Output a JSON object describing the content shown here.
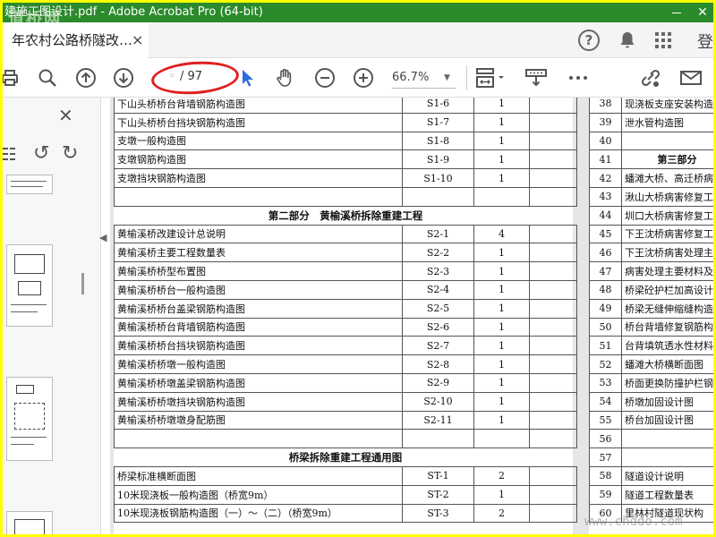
{
  "window": {
    "title": "建施工图设计.pdf - Adobe Acrobat Pro (64-bit)",
    "watermark": "道桥网",
    "close_glyph": "✕"
  },
  "tab": {
    "label": "年农村公路桥隧改…",
    "close_glyph": "×"
  },
  "header": {
    "help_glyph": "?",
    "signin_label": "登"
  },
  "toolbar": {
    "page_current": "",
    "page_total": "/ 97",
    "zoom": "66.7%"
  },
  "colors": {
    "titlebar": "#2b8a2b",
    "frame": "#ffff00",
    "highlight": "#e02020",
    "cursor": "#2d6cdf"
  },
  "left_table": {
    "rows": [
      {
        "kind": "row",
        "name": "下山头桥桥台背墙钢筋构造图",
        "code": "S1-6",
        "qty": "1"
      },
      {
        "kind": "row",
        "name": "下山头桥桥台挡块钢筋构造图",
        "code": "S1-7",
        "qty": "1"
      },
      {
        "kind": "row",
        "name": "支墩一般构造图",
        "code": "S1-8",
        "qty": "1"
      },
      {
        "kind": "row",
        "name": "支墩钢筋构造图",
        "code": "S1-9",
        "qty": "1"
      },
      {
        "kind": "row",
        "name": "支墩挡块钢筋构造图",
        "code": "S1-10",
        "qty": "1"
      },
      {
        "kind": "blank"
      },
      {
        "kind": "section",
        "name": "第二部分　黄榆溪桥拆除重建工程"
      },
      {
        "kind": "row",
        "name": "黄榆溪桥改建设计总说明",
        "code": "S2-1",
        "qty": "4"
      },
      {
        "kind": "row",
        "name": "黄榆溪桥主要工程数量表",
        "code": "S2-2",
        "qty": "1"
      },
      {
        "kind": "row",
        "name": "黄榆溪桥桥型布置图",
        "code": "S2-3",
        "qty": "1"
      },
      {
        "kind": "row",
        "name": "黄榆溪桥桥台一般构造图",
        "code": "S2-4",
        "qty": "1"
      },
      {
        "kind": "row",
        "name": "黄榆溪桥桥台盖梁钢筋构造图",
        "code": "S2-5",
        "qty": "1"
      },
      {
        "kind": "row",
        "name": "黄榆溪桥桥台背墙钢筋构造图",
        "code": "S2-6",
        "qty": "1"
      },
      {
        "kind": "row",
        "name": "黄榆溪桥桥台挡块钢筋构造图",
        "code": "S2-7",
        "qty": "1"
      },
      {
        "kind": "row",
        "name": "黄榆溪桥桥墩一般构造图",
        "code": "S2-8",
        "qty": "1"
      },
      {
        "kind": "row",
        "name": "黄榆溪桥桥墩盖梁钢筋构造图",
        "code": "S2-9",
        "qty": "1"
      },
      {
        "kind": "row",
        "name": "黄榆溪桥桥墩挡块钢筋构造图",
        "code": "S2-10",
        "qty": "1"
      },
      {
        "kind": "row",
        "name": "黄榆溪桥桥墩墩身配筋图",
        "code": "S2-11",
        "qty": "1"
      },
      {
        "kind": "blank"
      },
      {
        "kind": "section",
        "name": "桥梁拆除重建工程通用图"
      },
      {
        "kind": "row",
        "name": "桥梁标准横断面图",
        "code": "ST-1",
        "qty": "2"
      },
      {
        "kind": "row",
        "name": "10米现浇板一般构造图（桥宽9m）",
        "code": "ST-2",
        "qty": "1"
      },
      {
        "kind": "row",
        "name": "10米现浇板钢筋构造图（一）～（二）（桥宽9m）",
        "code": "ST-3",
        "qty": "2"
      }
    ]
  },
  "right_table": {
    "rows": [
      {
        "no": "38",
        "name": "现浇板支座安装构造"
      },
      {
        "no": "39",
        "name": "泄水管构造图"
      },
      {
        "no": "40",
        "name": ""
      },
      {
        "no": "41",
        "name": "第三部分",
        "bold": true
      },
      {
        "no": "42",
        "name": "蟠滩大桥、高迁桥病"
      },
      {
        "no": "43",
        "name": "湫山大桥病害修复工"
      },
      {
        "no": "44",
        "name": "圳口大桥病害修复工"
      },
      {
        "no": "45",
        "name": "下王沈桥病害修复工"
      },
      {
        "no": "46",
        "name": "下王沈桥病害处理主"
      },
      {
        "no": "47",
        "name": "病害处理主要材料及"
      },
      {
        "no": "48",
        "name": "桥梁砼护栏加高设计"
      },
      {
        "no": "49",
        "name": "桥梁无缝伸缩缝构造"
      },
      {
        "no": "50",
        "name": "桥台背墙修复钢筋构"
      },
      {
        "no": "51",
        "name": "台背填筑透水性材料"
      },
      {
        "no": "52",
        "name": "蟠滩大桥横断面图"
      },
      {
        "no": "53",
        "name": "桥面更换防撞护栏钢"
      },
      {
        "no": "54",
        "name": "桥墩加固设计图"
      },
      {
        "no": "55",
        "name": "桥台加固设计图"
      },
      {
        "no": "56",
        "name": ""
      },
      {
        "no": "57",
        "name": ""
      },
      {
        "no": "58",
        "name": "隧道设计说明"
      },
      {
        "no": "59",
        "name": "隧道工程数量表"
      },
      {
        "no": "60",
        "name": "里林村隧道现状构"
      }
    ]
  },
  "site_watermark": "www.chddo.com"
}
